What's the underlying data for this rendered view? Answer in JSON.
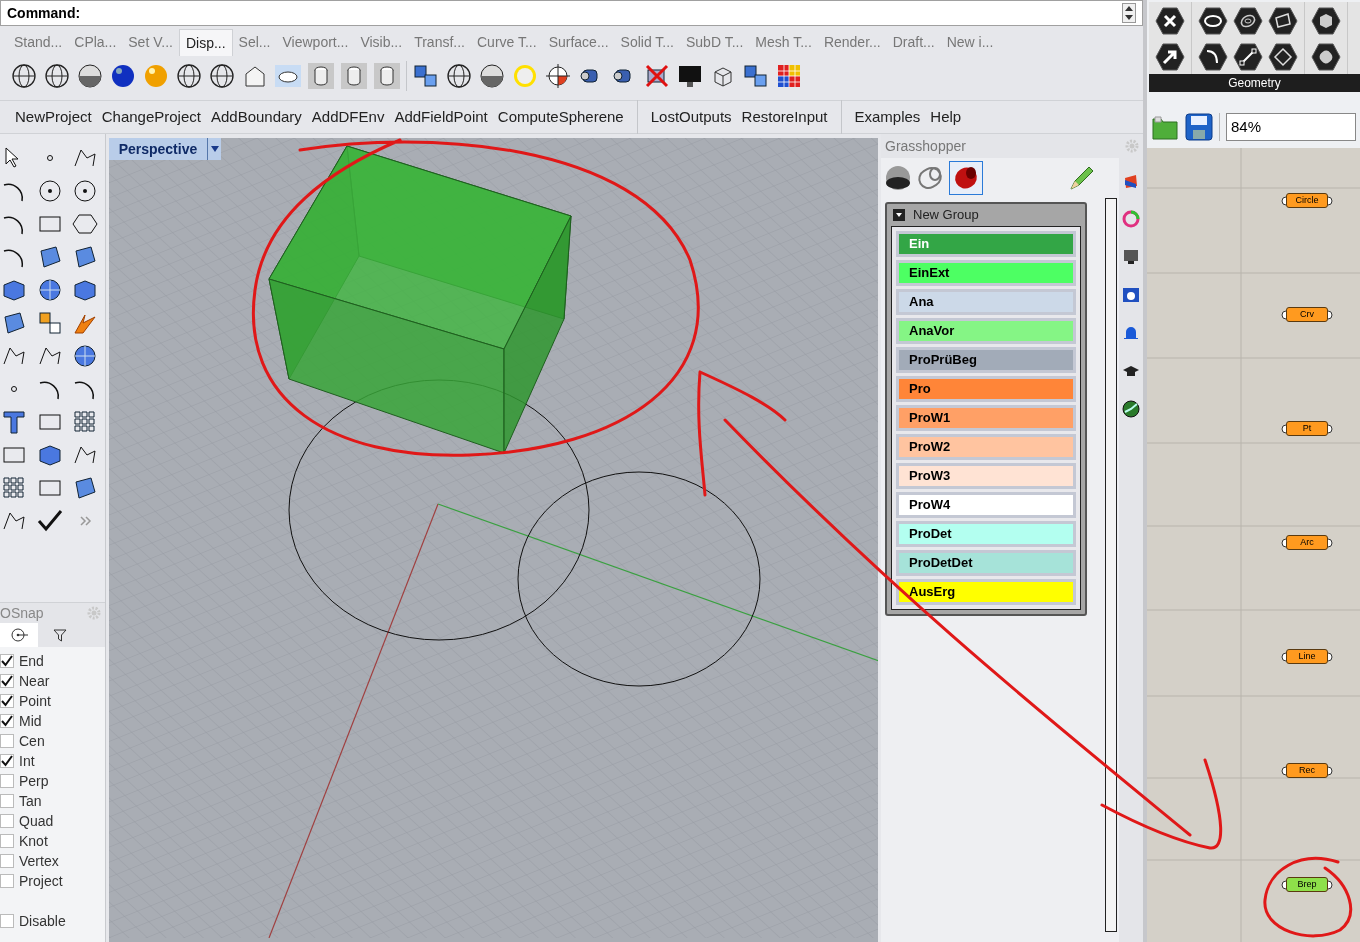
{
  "command": {
    "label": "Command:"
  },
  "tabs": [
    {
      "label": "Stand...",
      "selected": false
    },
    {
      "label": "CPla...",
      "selected": false
    },
    {
      "label": "Set V...",
      "selected": false
    },
    {
      "label": "Disp...",
      "selected": true
    },
    {
      "label": "Sel...",
      "selected": false
    },
    {
      "label": "Viewport...",
      "selected": false
    },
    {
      "label": "Visib...",
      "selected": false
    },
    {
      "label": "Transf...",
      "selected": false
    },
    {
      "label": "Curve T...",
      "selected": false
    },
    {
      "label": "Surface...",
      "selected": false
    },
    {
      "label": "Solid T...",
      "selected": false
    },
    {
      "label": "SubD T...",
      "selected": false
    },
    {
      "label": "Mesh T...",
      "selected": false
    },
    {
      "label": "Render...",
      "selected": false
    },
    {
      "label": "Draft...",
      "selected": false
    },
    {
      "label": "New i...",
      "selected": false
    }
  ],
  "menu_groups": [
    [
      "NewProject",
      "ChangeProject",
      "AddBoundary",
      "AddDFEnv",
      "AddFieldPoint",
      "ComputeSpherene"
    ],
    [
      "LostOutputs",
      "RestoreInput"
    ],
    [
      "Examples",
      "Help"
    ]
  ],
  "osnap": {
    "title": "OSnap",
    "items": [
      {
        "label": "End",
        "checked": true
      },
      {
        "label": "Near",
        "checked": true
      },
      {
        "label": "Point",
        "checked": true
      },
      {
        "label": "Mid",
        "checked": true
      },
      {
        "label": "Cen",
        "checked": false
      },
      {
        "label": "Int",
        "checked": true
      },
      {
        "label": "Perp",
        "checked": false
      },
      {
        "label": "Tan",
        "checked": false
      },
      {
        "label": "Quad",
        "checked": false
      },
      {
        "label": "Knot",
        "checked": false
      },
      {
        "label": "Vertex",
        "checked": false
      },
      {
        "label": "Project",
        "checked": false
      }
    ],
    "disable": {
      "label": "Disable",
      "checked": false
    }
  },
  "viewport": {
    "label": "Perspective"
  },
  "grasshopper": {
    "title": "Grasshopper",
    "group": {
      "title": "New Group",
      "expanded": true
    },
    "items": [
      {
        "label": "Ein",
        "color": "#33a646"
      },
      {
        "label": "EinExt",
        "color": "#4dff63"
      },
      {
        "label": "Ana",
        "color": "#ccd9e8"
      },
      {
        "label": "AnaVor",
        "color": "#85f585"
      },
      {
        "label": "ProPrüBeg",
        "color": "#a2abb8"
      },
      {
        "label": "Pro",
        "color": "#ff8538"
      },
      {
        "label": "ProW1",
        "color": "#ffa066"
      },
      {
        "label": "ProW2",
        "color": "#ffc4a0"
      },
      {
        "label": "ProW3",
        "color": "#ffe3d4"
      },
      {
        "label": "ProW4",
        "color": "#ffffff"
      },
      {
        "label": "ProDet",
        "color": "#b3fff0"
      },
      {
        "label": "ProDetDet",
        "color": "#a6e3d9"
      },
      {
        "label": "AusErg",
        "color": "#ffff00"
      }
    ]
  },
  "ribbon": {
    "section": "Geometry"
  },
  "zoom": {
    "value": "84%"
  },
  "canvas_nodes": [
    {
      "label": "Circle",
      "color": "#ff9a1f"
    },
    {
      "label": "Crv",
      "color": "#ff9a1f"
    },
    {
      "label": "Pt",
      "color": "#ff9a1f"
    },
    {
      "label": "Arc",
      "color": "#ff9a1f"
    },
    {
      "label": "Line",
      "color": "#ff9a1f"
    },
    {
      "label": "Rec",
      "color": "#ff9a1f"
    },
    {
      "label": "Brep",
      "color": "#8ee04a"
    }
  ]
}
